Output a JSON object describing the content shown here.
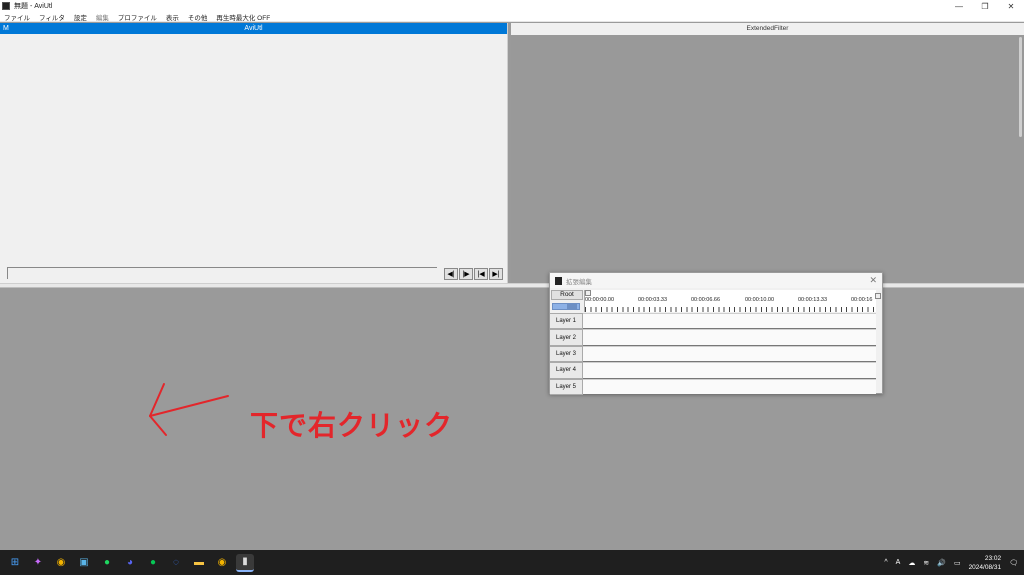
{
  "window": {
    "title": "無題 - AviUtl",
    "controls": {
      "minimize": "—",
      "restore": "❐",
      "close": "✕"
    }
  },
  "menu": [
    {
      "label": "ファイル",
      "dim": false
    },
    {
      "label": "フィルタ",
      "dim": false
    },
    {
      "label": "設定",
      "dim": false
    },
    {
      "label": "編集",
      "dim": true
    },
    {
      "label": "プロファイル",
      "dim": false
    },
    {
      "label": "表示",
      "dim": false
    },
    {
      "label": "その他",
      "dim": false
    },
    {
      "label": "再生時最大化 OFF",
      "dim": false
    }
  ],
  "aviutl_pane": {
    "mode_label": "M",
    "title": "AviUtl",
    "seek_buttons": [
      "◀|",
      "|▶",
      "|◀",
      "▶|"
    ]
  },
  "ext_pane": {
    "title": "ExtendedFilter"
  },
  "annotation": {
    "text": "下で右クリック",
    "color": "#e3262b"
  },
  "extended_edit": {
    "title": "拡張編集",
    "close": "✕",
    "root_label": "Root",
    "times": [
      "00:00:00.00",
      "00:00:03.33",
      "00:00:06.66",
      "00:00:10.00",
      "00:00:13.33",
      "00:00:16"
    ],
    "layers": [
      "Layer 1",
      "Layer 2",
      "Layer 3",
      "Layer 4",
      "Layer 5"
    ]
  },
  "taskbar": {
    "icons": [
      {
        "name": "windows-start-icon",
        "glyph": "⊞",
        "color": "#4aa3ff"
      },
      {
        "name": "copilot-icon",
        "glyph": "✦",
        "color": "#c86bfa"
      },
      {
        "name": "chrome-icon",
        "glyph": "◉",
        "color": "#f4b400"
      },
      {
        "name": "settings-app-icon",
        "glyph": "▣",
        "color": "#5ab4e8"
      },
      {
        "name": "spotify-icon",
        "glyph": "●",
        "color": "#1ed760"
      },
      {
        "name": "discord-icon",
        "glyph": "◕",
        "color": "#5865f2"
      },
      {
        "name": "line-icon",
        "glyph": "●",
        "color": "#06c755"
      },
      {
        "name": "signal-icon",
        "glyph": "◌",
        "color": "#3a76f0"
      },
      {
        "name": "file-explorer-icon",
        "glyph": "▬",
        "color": "#f6c343"
      },
      {
        "name": "chrome-icon-2",
        "glyph": "◉",
        "color": "#f4b400"
      },
      {
        "name": "aviutl-icon",
        "glyph": "▮",
        "color": "#dddddd"
      }
    ],
    "tray": {
      "chevron": "^",
      "ime": "A",
      "cloud": "☁",
      "wifi": "≋",
      "volume": "🔊",
      "battery": "▭",
      "time": "23:02",
      "date": "2024/08/31",
      "notify": "🗨"
    }
  }
}
